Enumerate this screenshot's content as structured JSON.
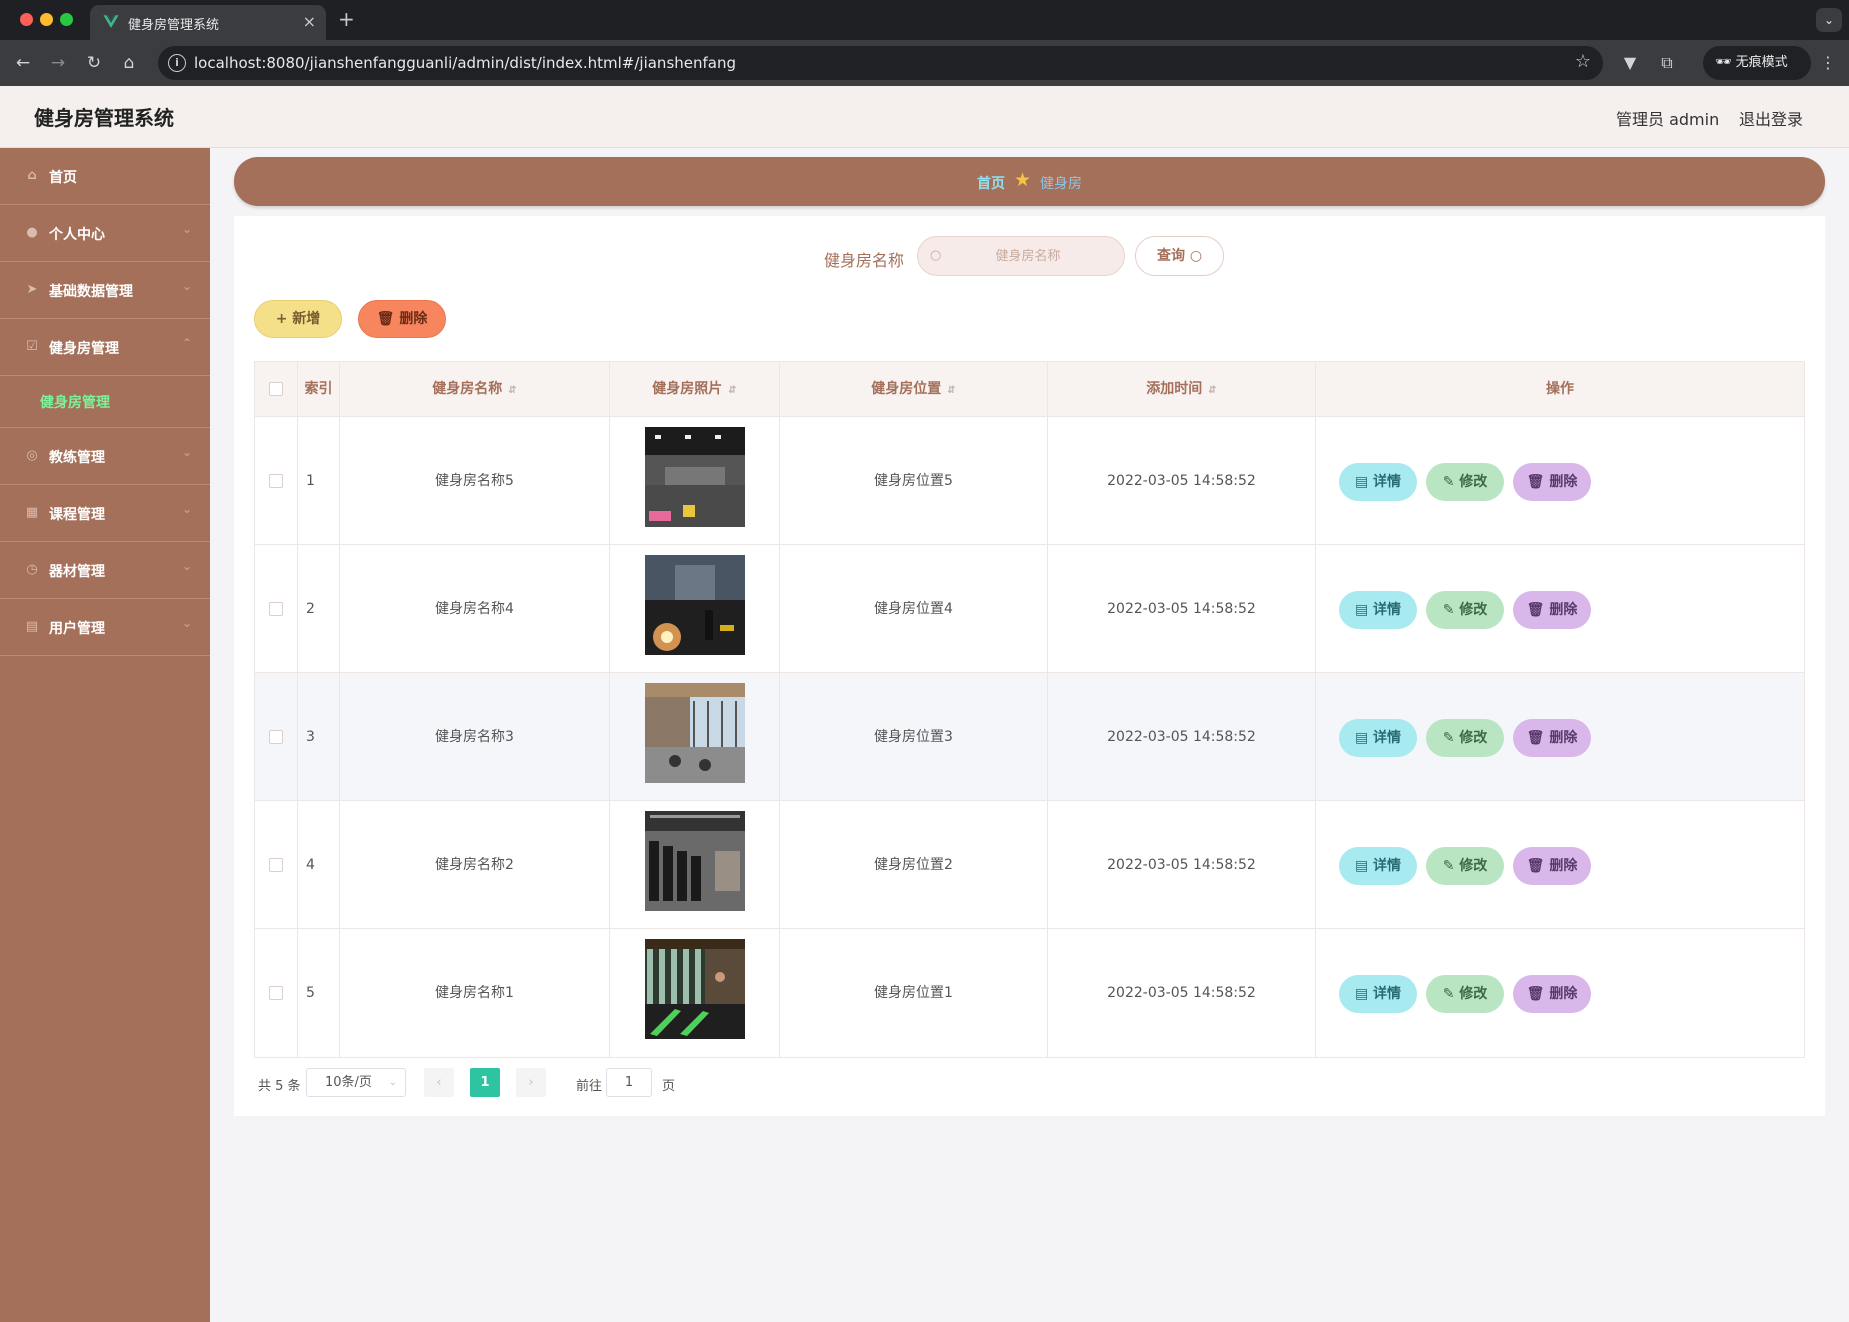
{
  "browser": {
    "tab_title": "健身房管理系统",
    "url": "localhost:8080/jianshenfangguanli/admin/dist/index.html#/jianshenfang",
    "incognito_label": "无痕模式"
  },
  "header": {
    "title": "健身房管理系统",
    "user": "管理员 admin",
    "logout": "退出登录"
  },
  "sidebar": {
    "items": [
      {
        "label": "首页",
        "icon": "home-icon"
      },
      {
        "label": "个人中心",
        "icon": "user-icon"
      },
      {
        "label": "基础数据管理",
        "icon": "send-icon"
      },
      {
        "label": "健身房管理",
        "icon": "checkbox-icon"
      },
      {
        "label": "教练管理",
        "icon": "compass-icon"
      },
      {
        "label": "课程管理",
        "icon": "grid-icon"
      },
      {
        "label": "器材管理",
        "icon": "clock-icon"
      },
      {
        "label": "用户管理",
        "icon": "document-icon"
      }
    ],
    "active_submenu": "健身房管理"
  },
  "breadcrumb": {
    "home": "首页",
    "current": "健身房"
  },
  "search": {
    "label": "健身房名称",
    "placeholder": "健身房名称",
    "button": "查询"
  },
  "actions": {
    "add": "新增",
    "delete": "删除"
  },
  "table": {
    "columns": [
      "索引",
      "健身房名称",
      "健身房照片",
      "健身房位置",
      "添加时间",
      "操作"
    ],
    "rows": [
      {
        "index": "1",
        "name": "健身房名称5",
        "location": "健身房位置5",
        "time": "2022-03-05 14:58:52"
      },
      {
        "index": "2",
        "name": "健身房名称4",
        "location": "健身房位置4",
        "time": "2022-03-05 14:58:52"
      },
      {
        "index": "3",
        "name": "健身房名称3",
        "location": "健身房位置3",
        "time": "2022-03-05 14:58:52"
      },
      {
        "index": "4",
        "name": "健身房名称2",
        "location": "健身房位置2",
        "time": "2022-03-05 14:58:52"
      },
      {
        "index": "5",
        "name": "健身房名称1",
        "location": "健身房位置1",
        "time": "2022-03-05 14:58:52"
      }
    ],
    "row_actions": {
      "detail": "详情",
      "edit": "修改",
      "delete": "删除"
    }
  },
  "pagination": {
    "total": "共 5 条",
    "page_size": "10条/页",
    "current": "1",
    "goto_label": "前往",
    "goto_value": "1",
    "page_suffix": "页"
  },
  "colors": {
    "sidebar": "#a4705a",
    "active_submenu": "#7cf29a",
    "page_current": "#2fc4a1"
  }
}
